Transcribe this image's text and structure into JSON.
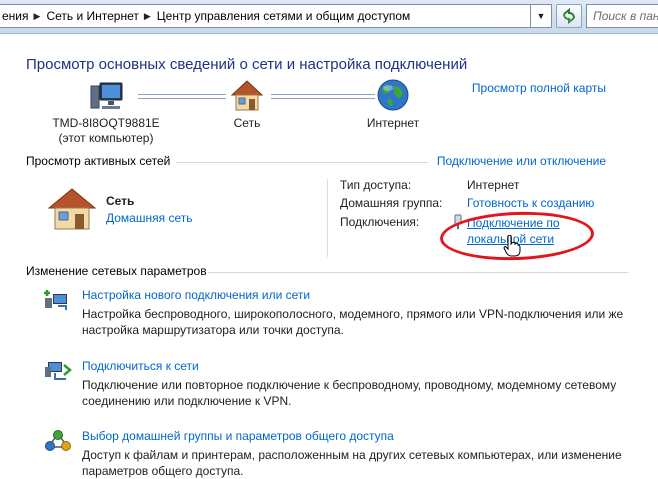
{
  "addressbar": {
    "breadcrumbs": [
      "ения",
      "Сеть и Интернет",
      "Центр управления сетями и общим доступом"
    ],
    "search_placeholder": "Поиск в панели"
  },
  "main": {
    "title": "Просмотр основных сведений о сети и настройка подключений",
    "full_map_link": "Просмотр полной карты",
    "network_map": {
      "computer_name": "TMD-8I8OQT9881E",
      "computer_sub": "(этот компьютер)",
      "network_label": "Сеть",
      "internet_label": "Интернет"
    },
    "active_networks": {
      "heading": "Просмотр активных сетей",
      "connect_link": "Подключение или отключение",
      "network_name": "Сеть",
      "network_type": "Домашняя сеть",
      "access_type_label": "Тип доступа:",
      "access_type_value": "Интернет",
      "homegroup_label": "Домашняя группа:",
      "homegroup_value": "Готовность к созданию",
      "connections_label": "Подключения:",
      "connection_line1": "Подключение по",
      "connection_line2": "локальной сети"
    },
    "change_settings": {
      "heading": "Изменение сетевых параметров",
      "tasks": [
        {
          "link": "Настройка нового подключения или сети",
          "desc": "Настройка беспроводного, широкополосного, модемного, прямого или VPN-подключения или же настройка маршрутизатора или точки доступа."
        },
        {
          "link": "Подключиться к сети",
          "desc": "Подключение или повторное подключение к беспроводному, проводному, модемному сетевому соединению или подключение к VPN."
        },
        {
          "link": "Выбор домашней группы и параметров общего доступа",
          "desc": "Доступ к файлам и принтерам, расположенным на других сетевых компьютерах, или изменение параметров общего доступа."
        }
      ]
    }
  },
  "colors": {
    "link": "#0066cc",
    "title": "#1e3287",
    "annotation": "#e3141c"
  }
}
